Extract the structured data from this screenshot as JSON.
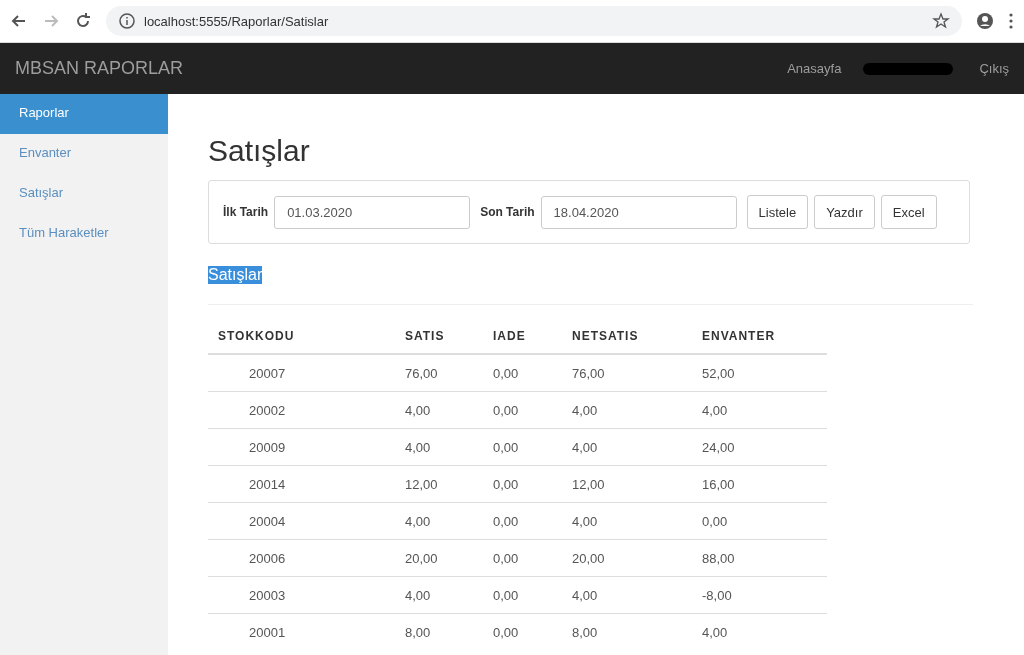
{
  "browser": {
    "url": "localhost:5555/Raporlar/Satislar"
  },
  "navbar": {
    "brand": "MBSAN RAPORLAR",
    "links": [
      "Anasayfa",
      "Çıkış"
    ]
  },
  "sidebar": {
    "items": [
      {
        "label": "Raporlar",
        "selected": true
      },
      {
        "label": "Envanter",
        "selected": false
      },
      {
        "label": "Satışlar",
        "selected": false
      },
      {
        "label": "Tüm Haraketler",
        "selected": false
      }
    ]
  },
  "page_title": "Satışlar",
  "filter": {
    "start_label": "İlk Tarih",
    "start_value": "01.03.2020",
    "end_label": "Son Tarih",
    "end_value": "18.04.2020",
    "buttons": [
      "Listele",
      "Yazdır",
      "Excel"
    ]
  },
  "section_title": "Satışlar",
  "table": {
    "columns": [
      "STOKKODU",
      "SATIS",
      "IADE",
      "NETSATIS",
      "ENVANTER"
    ],
    "rows": [
      [
        "20007",
        "76,00",
        "0,00",
        "76,00",
        "52,00"
      ],
      [
        "20002",
        "4,00",
        "0,00",
        "4,00",
        "4,00"
      ],
      [
        "20009",
        "4,00",
        "0,00",
        "4,00",
        "24,00"
      ],
      [
        "20014",
        "12,00",
        "0,00",
        "12,00",
        "16,00"
      ],
      [
        "20004",
        "4,00",
        "0,00",
        "4,00",
        "0,00"
      ],
      [
        "20006",
        "20,00",
        "0,00",
        "20,00",
        "88,00"
      ],
      [
        "20003",
        "4,00",
        "0,00",
        "4,00",
        "-8,00"
      ],
      [
        "20001",
        "8,00",
        "0,00",
        "8,00",
        "4,00"
      ]
    ]
  }
}
